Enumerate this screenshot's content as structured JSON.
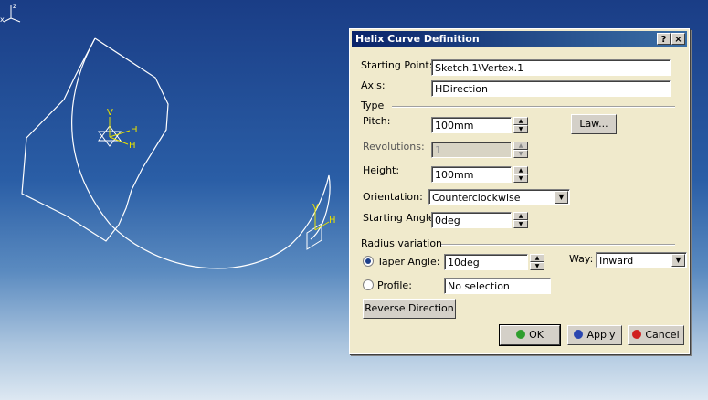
{
  "dialog": {
    "title": "Helix Curve Definition",
    "help_btn": "?",
    "close_btn": "×",
    "starting_point_label": "Starting Point:",
    "starting_point_value": "Sketch.1\\Vertex.1",
    "axis_label": "Axis:",
    "axis_value": "HDirection",
    "type_label": "Type",
    "pitch_label": "Pitch:",
    "pitch_value": "100mm",
    "law_button": "Law...",
    "revolutions_label": "Revolutions:",
    "revolutions_value": "1",
    "height_label": "Height:",
    "height_value": "100mm",
    "orientation_label": "Orientation:",
    "orientation_value": "Counterclockwise",
    "starting_angle_label": "Starting Angle:",
    "starting_angle_value": "0deg",
    "radius_variation_label": "Radius variation",
    "taper_angle_label": "Taper Angle:",
    "taper_angle_value": "10deg",
    "way_label": "Way:",
    "way_value": "Inward",
    "profile_label": "Profile:",
    "profile_value": "No selection",
    "reverse_button": "Reverse Direction",
    "ok_button": "OK",
    "apply_button": "Apply",
    "cancel_button": "Cancel"
  },
  "viewport": {
    "axis_labels": {
      "v": "V",
      "h": "H"
    },
    "triad_labels": {
      "z": "z",
      "x": "x"
    }
  },
  "colors": {
    "dialog_bg": "#f0eacc",
    "title_bar": "#0a246a",
    "geometry": "#ffffff",
    "axis": "#e8e000",
    "ok_dot": "#2e9e2e",
    "apply_dot": "#2a46b0",
    "cancel_dot": "#d02020"
  }
}
